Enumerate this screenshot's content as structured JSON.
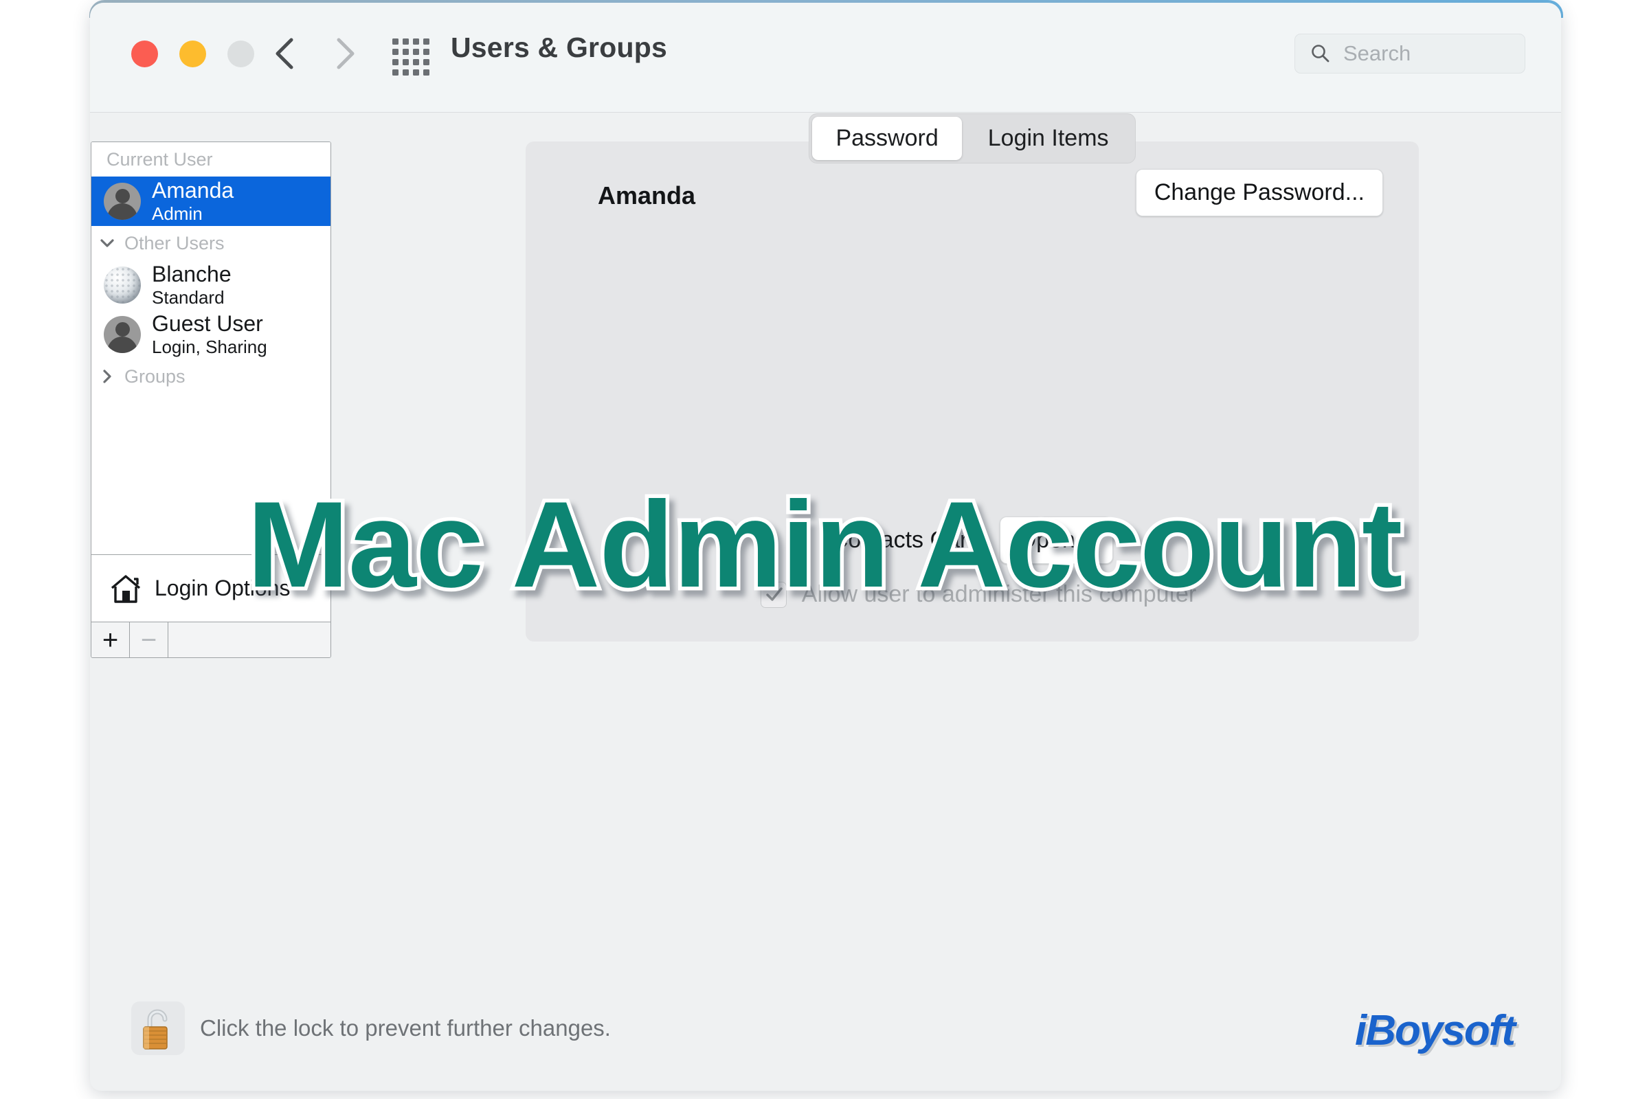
{
  "window": {
    "title": "Users & Groups",
    "traffic_lights": [
      "close",
      "minimize",
      "zoom"
    ],
    "nav": {
      "back": "back-chevron",
      "forward": "forward-chevron"
    },
    "grid_icon": "show-all-preferences-grid-icon"
  },
  "search": {
    "placeholder": "Search",
    "value": "",
    "icon": "search-icon"
  },
  "sidebar": {
    "sections": [
      {
        "header": "Current User",
        "collapsible": false,
        "users": [
          {
            "name": "Amanda",
            "role": "Admin",
            "avatar": "person-icon",
            "selected": true
          }
        ]
      },
      {
        "header": "Other Users",
        "collapsible": true,
        "chevron": "chevron-down-icon",
        "users": [
          {
            "name": "Blanche",
            "role": "Standard",
            "avatar": "golf-ball-icon",
            "selected": false
          },
          {
            "name": "Guest User",
            "role": "Login, Sharing",
            "avatar": "person-icon",
            "selected": false
          }
        ]
      },
      {
        "header": "Groups",
        "collapsible": true,
        "chevron": "chevron-right-icon",
        "users": []
      }
    ],
    "login_options": {
      "label": "Login Options",
      "icon": "house-icon"
    },
    "add_button": "+",
    "remove_button": "−"
  },
  "main": {
    "tabs": [
      {
        "label": "Password",
        "active": true
      },
      {
        "label": "Login Items",
        "active": false
      }
    ],
    "account_name": "Amanda",
    "change_password_label": "Change Password...",
    "contacts_card_label": "Contacts Card:",
    "contacts_open_label": "Open...",
    "admin_checkbox": {
      "label": "Allow user to administer this computer",
      "checked": true,
      "disabled": true
    }
  },
  "footer": {
    "lock_icon": "unlocked-padlock-icon",
    "text": "Click the lock to prevent further changes.",
    "logo": "iBoysoft"
  },
  "overlay": {
    "watermark_text": "Mac Admin Account",
    "watermark_color": "#0d8573"
  }
}
